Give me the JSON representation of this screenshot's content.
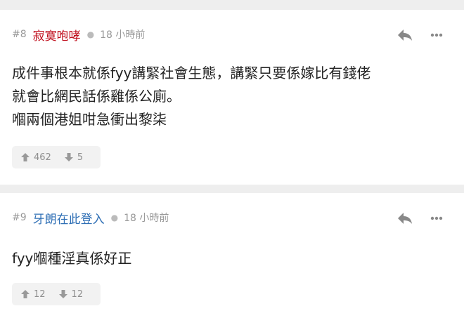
{
  "posts": [
    {
      "number": "#8",
      "author": "寂寞咆哮",
      "author_color": "#c0101e",
      "time": "18 小時前",
      "body": "成件事根本就係fyy講緊社會生態，講緊只要係嫁比有錢佬\n就會比網民話係雞係公廁。\n嗰兩個港姐咁急衝出黎柒",
      "likes": "462",
      "dislikes": "5"
    },
    {
      "number": "#9",
      "author": "牙朗在此登入",
      "author_color": "#2f6fb5",
      "time": "18 小時前",
      "body": "fyy嗰種淫真係好正",
      "likes": "12",
      "dislikes": "12"
    }
  ],
  "icons": {
    "reply": "reply-icon",
    "more": "more-icon",
    "upvote": "thumb-up-arrow-icon",
    "downvote": "thumb-down-arrow-icon"
  },
  "colors": {
    "meta_gray": "#999999",
    "background": "#eeeeee"
  }
}
